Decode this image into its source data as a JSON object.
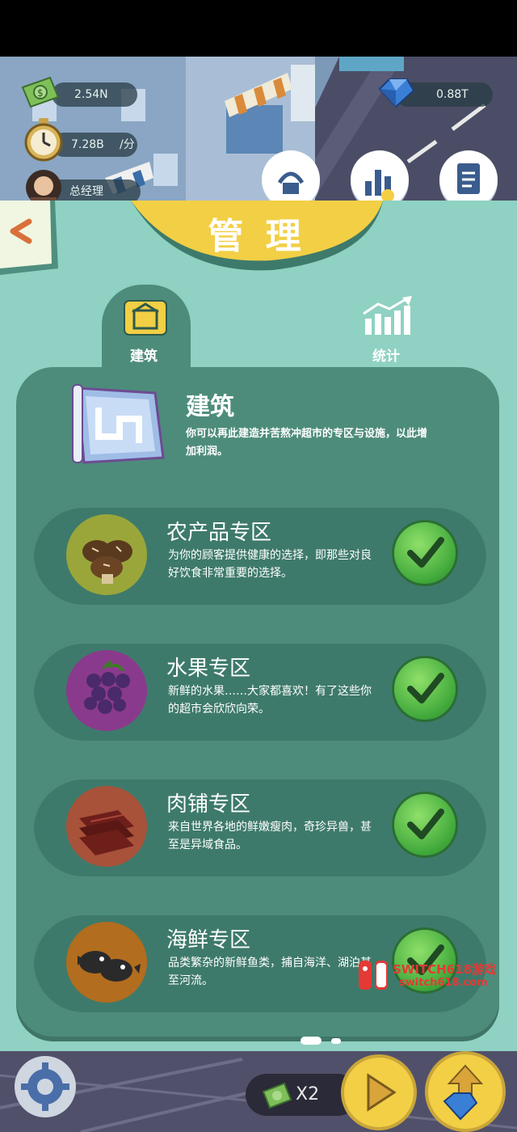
{
  "hud": {
    "cash": "2.54N",
    "income_rate": "7.28B",
    "income_unit": "/分",
    "gems": "0.88T",
    "manager_label": "总经理"
  },
  "panel": {
    "title": "管 理",
    "tabs": [
      {
        "label": "建筑",
        "icon": "building-icon",
        "active": true
      },
      {
        "label": "统计",
        "icon": "stats-chart-icon",
        "active": false
      }
    ],
    "section": {
      "title": "建筑",
      "description": "你可以再此建造并苦熬冲超市的专区与设施，以此增加利润。"
    },
    "zones": [
      {
        "name": "农产品专区",
        "desc": "为你的顾客提供健康的选择，即那些对良好饮食非常重要的选择。",
        "icon": "mushroom-icon",
        "icon_bg": "#9aa63a",
        "built": true
      },
      {
        "name": "水果专区",
        "desc": "新鲜的水果……大家都喜欢！有了这些你的超市会欣欣向荣。",
        "icon": "grapes-icon",
        "icon_bg": "#8a3a8c",
        "built": true
      },
      {
        "name": "肉铺专区",
        "desc": "来自世界各地的鲜嫩瘦肉，奇珍异兽，甚至是异域食品。",
        "icon": "meat-icon",
        "icon_bg": "#a8523a",
        "built": true
      },
      {
        "name": "海鲜专区",
        "desc": "品类繁杂的新鲜鱼类，捕自海洋、湖泊甚至河流。",
        "icon": "pufferfish-icon",
        "icon_bg": "#b26d1e",
        "built": true
      }
    ]
  },
  "bottom_bar": {
    "multiplier": "X2"
  },
  "watermark": {
    "line1": "SWITCH618游戏",
    "line2": "switch618.com"
  },
  "colors": {
    "panel_bg": "#8fd1c2",
    "card_bg": "#3e7a6b",
    "banner_yellow": "#f2cf45",
    "check_green": "#4caf3f"
  }
}
